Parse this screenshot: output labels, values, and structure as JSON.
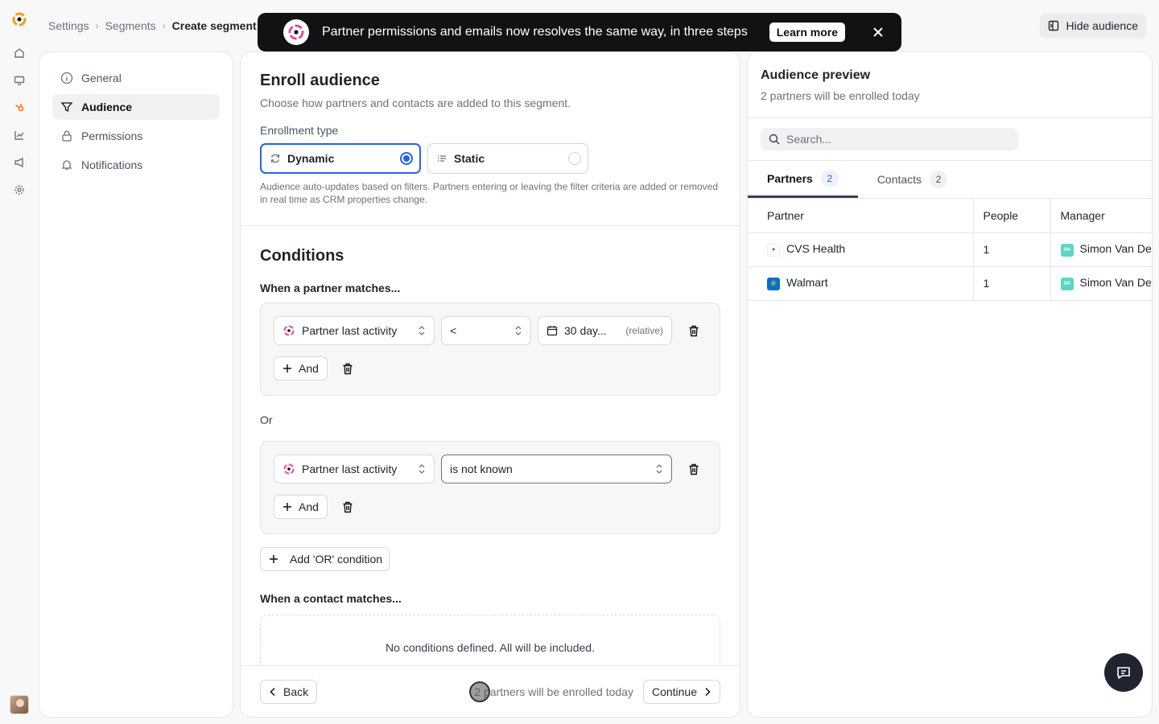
{
  "breadcrumb": [
    "Settings",
    "Segments",
    "Create segment"
  ],
  "toast": {
    "text": "Partner permissions and emails now resolves the same way, in three steps",
    "button": "Learn more"
  },
  "hide_audience": "Hide audience",
  "nav": [
    {
      "label": "General",
      "icon": "info-icon"
    },
    {
      "label": "Audience",
      "icon": "filter-icon"
    },
    {
      "label": "Permissions",
      "icon": "lock-icon"
    },
    {
      "label": "Notifications",
      "icon": "bell-icon"
    }
  ],
  "enroll": {
    "title": "Enroll audience",
    "subtitle": "Choose how partners and contacts are added to this segment.",
    "type_label": "Enrollment type",
    "options": [
      {
        "label": "Dynamic",
        "selected": true
      },
      {
        "label": "Static",
        "selected": false
      }
    ],
    "help": "Audience auto-updates based on filters. Partners entering or leaving the filter criteria are added or removed in real time as CRM properties change."
  },
  "conditions": {
    "title": "Conditions",
    "partner_heading": "When a partner matches...",
    "groups": [
      {
        "property": "Partner last activity",
        "operator": "<",
        "value": "30 day...",
        "value_hint": "(relative)"
      },
      {
        "property": "Partner last activity",
        "operator": "is not known"
      }
    ],
    "and_label": "And",
    "or_label": "Or",
    "add_or": "Add 'OR' condition",
    "contact_heading": "When a contact matches...",
    "empty": "No conditions defined. All will be included."
  },
  "footer": {
    "back": "Back",
    "note": "2 partners will be enrolled today",
    "continue": "Continue"
  },
  "preview": {
    "title": "Audience preview",
    "subtitle": "2 partners will be enrolled today",
    "search_placeholder": "Search...",
    "tabs": [
      {
        "label": "Partners",
        "count": "2"
      },
      {
        "label": "Contacts",
        "count": "2"
      }
    ],
    "columns": [
      "Partner",
      "People",
      "Manager"
    ],
    "rows": [
      {
        "partner": "CVS Health",
        "people": "1",
        "manager": "Simon Van De",
        "manager_initials": "SH"
      },
      {
        "partner": "Walmart",
        "people": "1",
        "manager": "Simon Van De",
        "manager_initials": "SH"
      }
    ]
  },
  "colors": {
    "accent": "#2563eb",
    "toast_bg": "#111214",
    "chat_bg": "#1f2430"
  }
}
